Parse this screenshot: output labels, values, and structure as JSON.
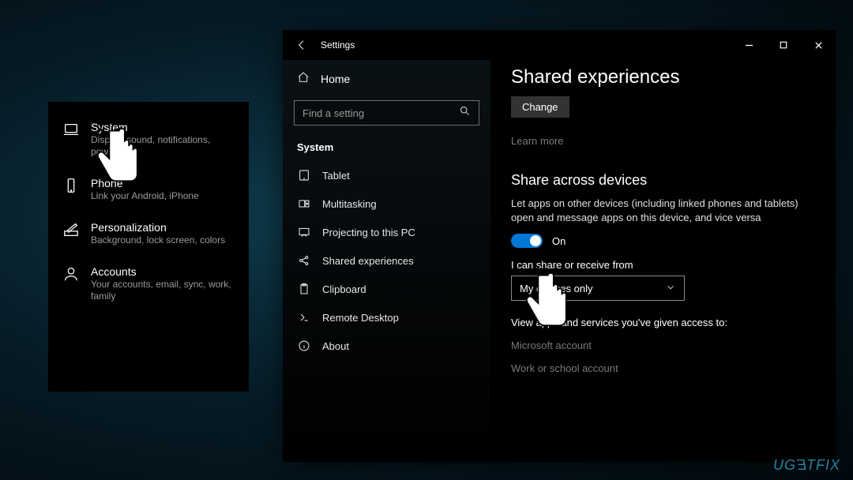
{
  "categories": [
    {
      "title": "System",
      "sub": "Display, sound, notifications, power"
    },
    {
      "title": "Phone",
      "sub": "Link your Android, iPhone"
    },
    {
      "title": "Personalization",
      "sub": "Background, lock screen, colors"
    },
    {
      "title": "Accounts",
      "sub": "Your accounts, email, sync, work, family"
    }
  ],
  "window": {
    "title": "Settings",
    "home": "Home",
    "search_placeholder": "Find a setting",
    "section": "System",
    "nav": [
      "Tablet",
      "Multitasking",
      "Projecting to this PC",
      "Shared experiences",
      "Clipboard",
      "Remote Desktop",
      "About"
    ]
  },
  "content": {
    "heading": "Shared experiences",
    "change": "Change",
    "learn_more": "Learn more",
    "share_heading": "Share across devices",
    "share_desc": "Let apps on other devices (including linked phones and tablets) open and message apps on this device, and vice versa",
    "toggle_label": "On",
    "receive_label": "I can share or receive from",
    "dropdown_value": "My devices only",
    "view_apps": "View apps and services you've given access to:",
    "acct1": "Microsoft account",
    "acct2": "Work or school account"
  },
  "watermark": "UGETFIX"
}
